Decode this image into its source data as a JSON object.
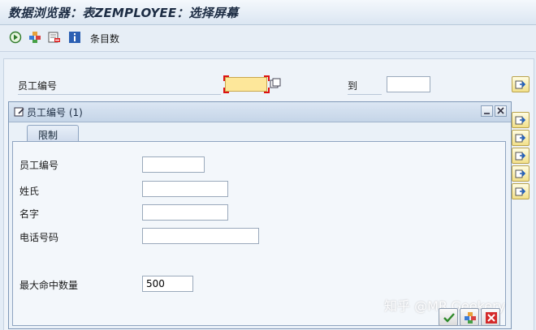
{
  "window": {
    "title": "数据浏览器：表ZEMPLOYEE：选择屏幕"
  },
  "toolbar": {
    "execute_icon": "execute-icon",
    "get_variant_icon": "get-variant-icon",
    "delete_icon": "delete-icon",
    "info_icon": "info-icon",
    "entries_label": "条目数"
  },
  "main": {
    "employee_id_label": "员工编号",
    "to_label": "到",
    "employee_id_from": "",
    "employee_id_to": ""
  },
  "dialog": {
    "title": "员工编号 (1)",
    "tab_label": "限制",
    "fields": {
      "employee_id_label": "员工编号",
      "surname_label": "姓氏",
      "firstname_label": "名字",
      "phone_label": "电话号码",
      "max_hits_label": "最大命中数量",
      "max_hits_value": "500"
    }
  },
  "watermark": "知乎 @MR.Geekery",
  "colors": {
    "required_field": "#fde79a",
    "title_bg": "#dbe6f2",
    "dialog_border": "#7f98b7"
  }
}
